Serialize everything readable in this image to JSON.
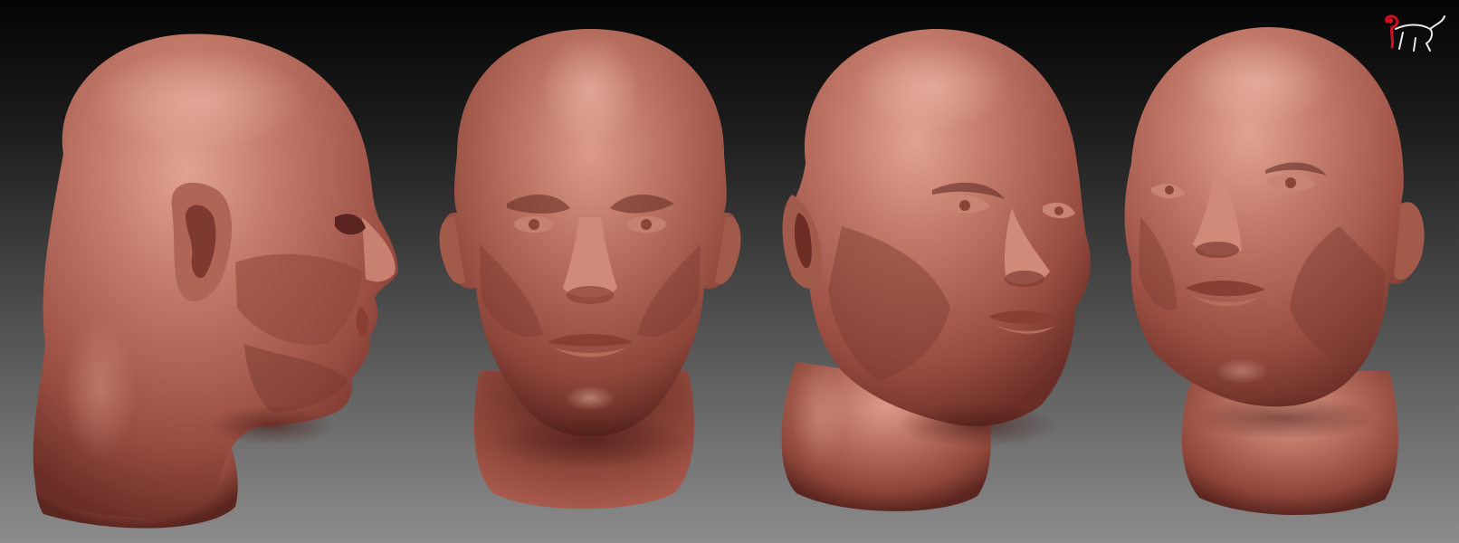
{
  "scene": {
    "background_top": "#050505",
    "background_bottom": "#8a8a8a",
    "clay_base": "#a85a4c",
    "clay_highlight": "#e8a898",
    "clay_shadow": "#5e2a22",
    "views": [
      {
        "name": "left-profile-view"
      },
      {
        "name": "front-view"
      },
      {
        "name": "three-quarter-left-view"
      },
      {
        "name": "three-quarter-right-view"
      }
    ]
  },
  "logo": {
    "icon": "monkey-logo-icon",
    "accent_color": "#d01020",
    "line_color": "#e8e8e8"
  }
}
